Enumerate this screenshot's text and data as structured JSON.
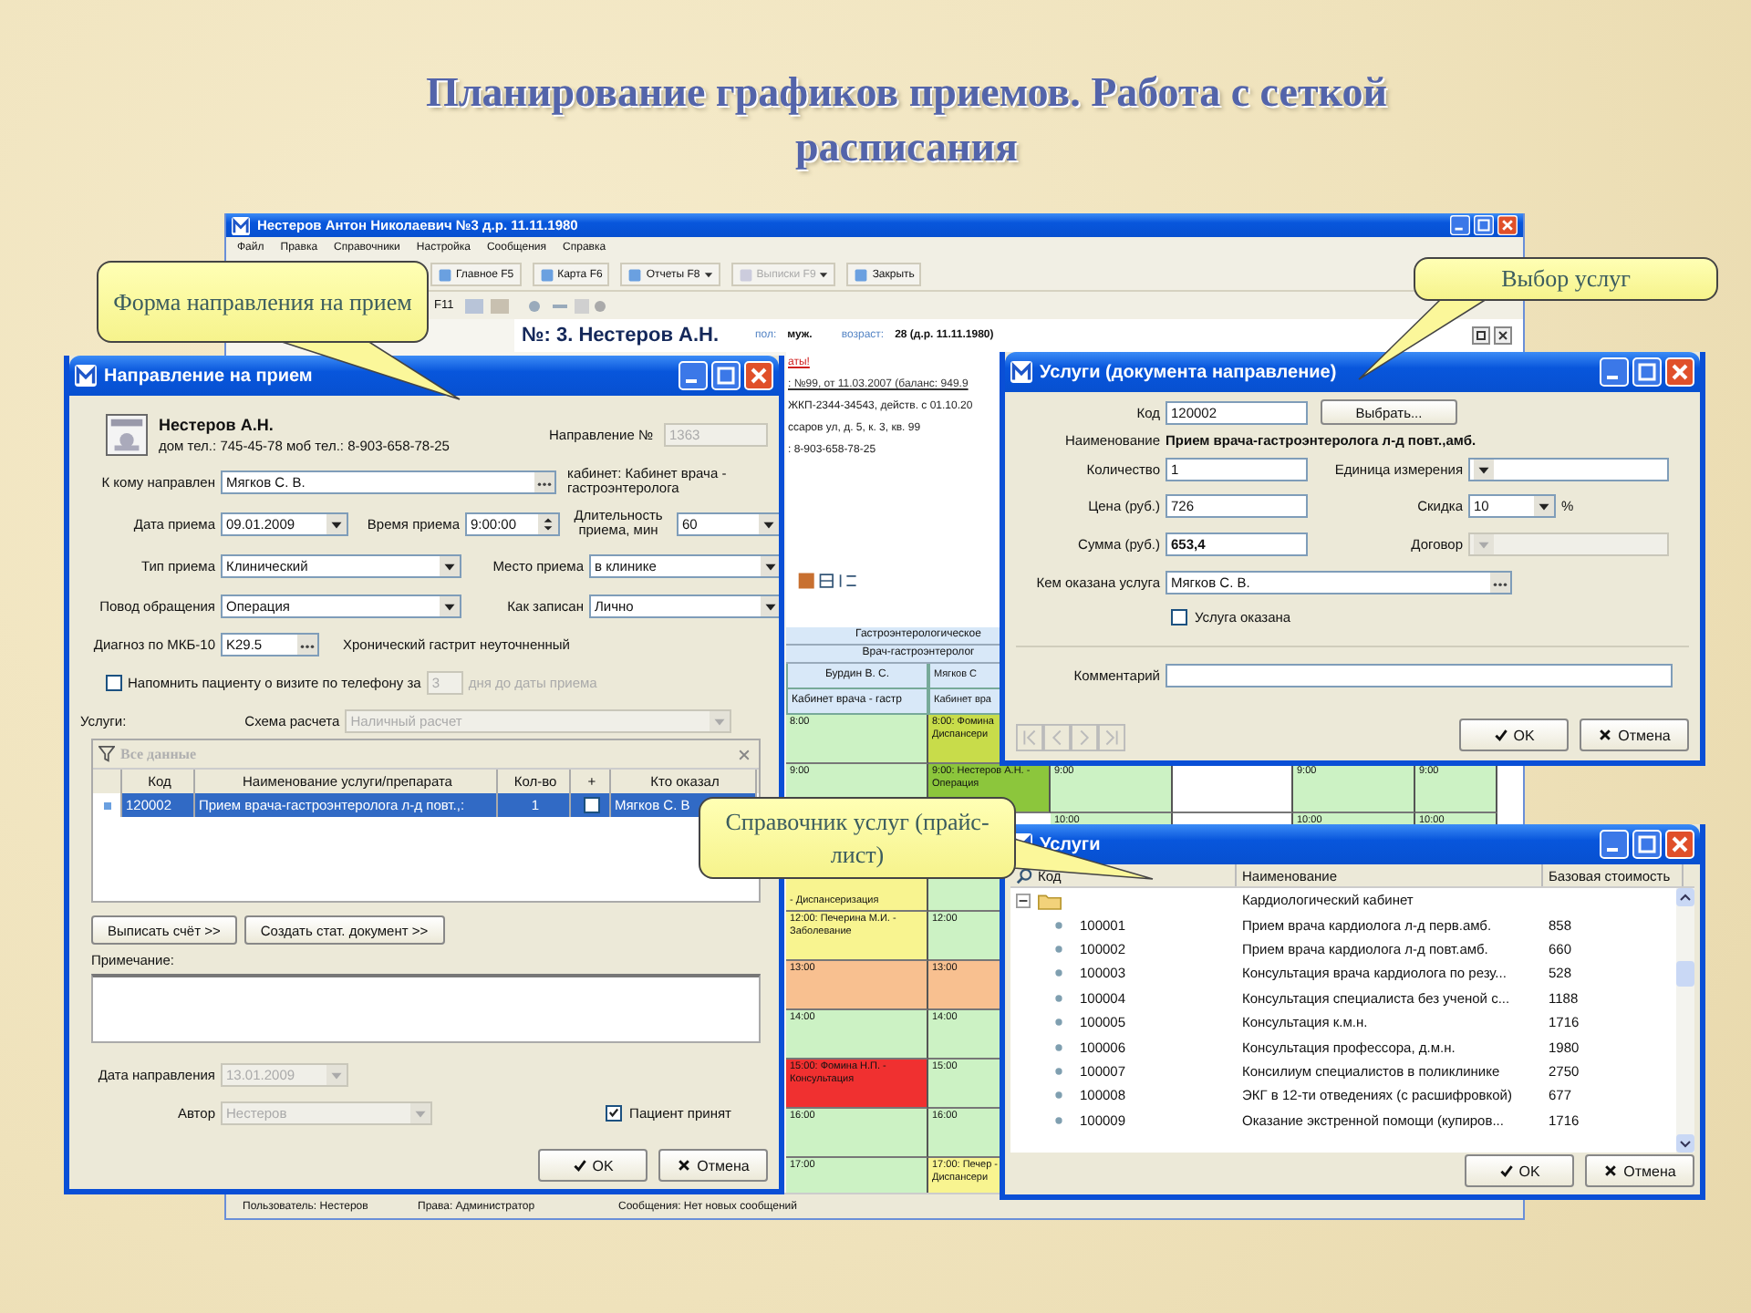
{
  "slide_title": "Планирование графиков приемов. Работа с сеткой расписания",
  "main_window": {
    "title": "Нестеров Антон Николаевич №3 д.р. 11.11.1980",
    "menu": [
      "Файл",
      "Правка",
      "Справочники",
      "Настройка",
      "Сообщения",
      "Справка"
    ],
    "toolbar": [
      {
        "label": "Главное F5",
        "disabled": false,
        "dropdown": false
      },
      {
        "label": "Карта F6",
        "disabled": false,
        "dropdown": false
      },
      {
        "label": "Отчеты F8",
        "disabled": false,
        "dropdown": true
      },
      {
        "label": "Выписки F9",
        "disabled": true,
        "dropdown": true
      },
      {
        "label": "Закрыть",
        "disabled": false,
        "dropdown": false
      }
    ],
    "toolbar2_label": "F11",
    "patient_header": {
      "number": "№: 3. Нестеров А.Н.",
      "sex_label": "пол:",
      "sex": "муж.",
      "age_label": "возраст:",
      "age": "28 (д.р. 11.11.1980)"
    },
    "info_lines": [
      {
        "text": "аты!",
        "kind": "warning"
      },
      {
        "text": ": №99, от 11.03.2007 (баланс: 949.9",
        "kind": "link"
      },
      {
        "text": "ЖКП-2344-34543, действ. с 01.10.20",
        "kind": "plain"
      },
      {
        "text": "ссаров ул, д. 5, к. 3, кв. 99",
        "kind": "plain"
      },
      {
        "text": ": 8-903-658-78-25",
        "kind": "plain"
      }
    ],
    "schedule": {
      "department": "Гастроэнтерологическое",
      "specialty": "Врач-гастроэнтеролог",
      "doctors": [
        "Бурдин В. С.",
        "Мягков С"
      ],
      "rooms": [
        "Кабинет врача - гастр",
        "Кабинет вра"
      ],
      "rows": [
        {
          "cells": [
            {
              "kind": "slot",
              "text": "8:00",
              "color": "#ccf2c4"
            },
            {
              "kind": "slot",
              "text": "8:00: Фомина Диспансери",
              "color": "#c8dc4a"
            }
          ]
        },
        {
          "cells": [
            {
              "kind": "slot",
              "text": "9:00",
              "color": "#ccf2c4"
            },
            {
              "kind": "slot",
              "text": "9:00: Нестеров А.Н. - Операция",
              "color": "#8cc63c"
            },
            {
              "kind": "slot",
              "text": "9:00",
              "color": "#ccf2c4"
            },
            {
              "kind": "slot",
              "color": "#ffffff"
            },
            {
              "kind": "slot",
              "text": "9:00",
              "color": "#ccf2c4"
            },
            {
              "kind": "slot",
              "text": "9:00",
              "color": "#ccf2c4"
            }
          ]
        },
        {
          "cells": [
            {},
            {},
            {
              "kind": "slot",
              "text": "10:00",
              "color": "#ccf2c4"
            },
            {
              "kind": "slot",
              "color": "#ffffff"
            },
            {
              "kind": "slot",
              "text": "10:00",
              "color": "#ccf2c4"
            },
            {
              "kind": "slot",
              "text": "10:00",
              "color": "#ccf2c4"
            }
          ]
        },
        {
          "cells": [
            {
              "kind": "continuation",
              "text": "- Диспансеризация",
              "color": "#f8f490"
            },
            {
              "kind": "slot",
              "color": "#ccf2c4"
            }
          ]
        },
        {
          "cells": [
            {
              "kind": "slot",
              "text": "12:00: Печерина М.И. - Заболевание",
              "color": "#f8f490"
            },
            {
              "kind": "slot",
              "text": "12:00",
              "color": "#ccf2c4"
            }
          ]
        },
        {
          "cells": [
            {
              "kind": "slot",
              "text": "13:00",
              "color": "#f8c090"
            },
            {
              "kind": "slot",
              "text": "13:00",
              "color": "#f8c090"
            }
          ]
        },
        {
          "cells": [
            {
              "kind": "slot",
              "text": "14:00",
              "color": "#ccf2c4"
            },
            {
              "kind": "slot",
              "text": "14:00",
              "color": "#ccf2c4"
            }
          ]
        },
        {
          "cells": [
            {
              "kind": "slot",
              "text": "15:00: Фомина Н.П. - Консультация",
              "color": "#f03030"
            },
            {
              "kind": "slot",
              "text": "15:00",
              "color": "#ccf2c4"
            }
          ]
        },
        {
          "cells": [
            {
              "kind": "slot",
              "text": "16:00",
              "color": "#ccf2c4"
            },
            {
              "kind": "slot",
              "text": "16:00",
              "color": "#ccf2c4"
            }
          ]
        },
        {
          "cells": [
            {
              "kind": "slot",
              "text": "17:00",
              "color": "#ccf2c4"
            },
            {
              "kind": "slot",
              "text": "17:00: Печер - Диспансери",
              "color": "#f8f490"
            }
          ]
        }
      ]
    },
    "status_bar": [
      "Пользователь:  Нестеров",
      "Права:  Администратор",
      "Сообщения:  Нет новых сообщений"
    ]
  },
  "referral_dialog": {
    "title": "Направление на прием",
    "patient_name": "Нестеров А.Н.",
    "patient_phones": "дом тел.: 745-45-78 моб тел.: 8-903-658-78-25",
    "number": {
      "label": "Направление №",
      "value": "1363",
      "kind": "text",
      "disabled": true
    },
    "to_whom": {
      "label": "К кому направлен",
      "value": "Мягков С. В.",
      "kind": "lookup",
      "disabled": false
    },
    "room_note": "кабинет: Кабинет врача - гастроэнтеролога",
    "date": {
      "label": "Дата приема",
      "value": "09.01.2009",
      "kind": "combo",
      "disabled": false
    },
    "time": {
      "label": "Время приема",
      "value": "9:00:00",
      "kind": "spin",
      "disabled": false
    },
    "duration": {
      "label": "Длительность приема, мин",
      "value": "60",
      "kind": "combo",
      "disabled": false
    },
    "type": {
      "label": "Тип приема",
      "value": "Клинический",
      "kind": "combo",
      "disabled": false
    },
    "place": {
      "label": "Место приема",
      "value": "в клинике",
      "kind": "combo",
      "disabled": false
    },
    "reason": {
      "label": "Повод обращения",
      "value": "Операция",
      "kind": "combo",
      "disabled": false
    },
    "recorded": {
      "label": "Как записан",
      "value": "Лично",
      "kind": "combo",
      "disabled": false
    },
    "diagnosis": {
      "label": "Диагноз по МКБ-10",
      "value": "K29.5",
      "kind": "lookup",
      "disabled": false
    },
    "diagnosis_text": "Хронический гастрит неуточненный",
    "reminder": {
      "label": "Напомнить пациенту о визите по телефону за",
      "checked": false,
      "days": "3",
      "suffix": "дня до даты приема",
      "disabled": true
    },
    "services_label": "Услуги:",
    "payment": {
      "label": "Схема расчета",
      "value": "Наличный расчет",
      "kind": "combo",
      "disabled": true
    },
    "filter": "Все данные",
    "columns": [
      "Код",
      "Наименование услуги/препарата",
      "Кол-во",
      "+",
      "Кто оказал"
    ],
    "rows": [
      {
        "code": "120002",
        "name": "Прием врача-гастроэнтеролога л-д повт.,:",
        "qty": "1",
        "extra": false,
        "by": "Мягков С. В",
        "selected": true
      }
    ],
    "actions": [
      "Выписать счёт >>",
      "Создать стат. документ >>"
    ],
    "note_label": "Примечание:",
    "referral_date": {
      "label": "Дата направления",
      "value": "13.01.2009",
      "kind": "combo",
      "disabled": true
    },
    "author": {
      "label": "Автор",
      "value": "Нестеров",
      "kind": "combo",
      "disabled": true
    },
    "accepted": {
      "label": "Пациент принят",
      "checked": true
    },
    "ok": "OK",
    "cancel": "Отмена"
  },
  "service_dialog": {
    "title": "Услуги (документа направление)",
    "code": {
      "label": "Код",
      "value": "120002",
      "kind": "text",
      "disabled": false
    },
    "choose_button": "Выбрать...",
    "name_label": "Наименование",
    "name_value": "Прием врача-гастроэнтеролога л-д повт.,амб.",
    "quantity": {
      "label": "Количество",
      "value": "1",
      "kind": "text",
      "disabled": false
    },
    "unit": {
      "label": "Единица измерения",
      "kind": "combo",
      "disabled": false
    },
    "price": {
      "label": "Цена (руб.)",
      "value": "726",
      "kind": "text",
      "disabled": false
    },
    "discount": {
      "label": "Скидка",
      "value": "10",
      "kind": "combo",
      "disabled": false
    },
    "percent": "%",
    "sum": {
      "label": "Сумма (руб.)",
      "value": "653,4",
      "kind": "text",
      "disabled": false
    },
    "contract": {
      "label": "Договор",
      "kind": "combo",
      "disabled": true
    },
    "performer": {
      "label": "Кем оказана услуга",
      "value": "Мягков С. В.",
      "kind": "lookup",
      "disabled": false
    },
    "done": {
      "label": "Услуга оказана",
      "checked": false
    },
    "comment_label": "Комментарий",
    "nav_disabled": true,
    "ok": "OK",
    "cancel": "Отмена"
  },
  "price_list": {
    "title": "Услуги",
    "columns": [
      "Код",
      "Наименование",
      "Базовая стоимость"
    ],
    "group": {
      "name": "Кардиологический кабинет",
      "expanded": true,
      "children": [
        {
          "code": "100001",
          "name": "Прием врача кардиолога л-д перв.амб.",
          "price": "858"
        },
        {
          "code": "100002",
          "name": "Прием врача кардиолога л-д повт.амб.",
          "price": "660"
        },
        {
          "code": "100003",
          "name": "Консультация врача кардиолога по резу...",
          "price": "528"
        },
        {
          "code": "100004",
          "name": "Консультация специалиста без ученой с...",
          "price": "1188"
        },
        {
          "code": "100005",
          "name": "Консультация к.м.н.",
          "price": "1716"
        },
        {
          "code": "100006",
          "name": "Консультация профессора, д.м.н.",
          "price": "1980"
        },
        {
          "code": "100007",
          "name": "Консилиум специалистов в поликлинике",
          "price": "2750"
        },
        {
          "code": "100008",
          "name": "ЭКГ в 12-ти отведениях (с расшифровкой)",
          "price": "677"
        },
        {
          "code": "100009",
          "name": "Оказание экстренной помощи (купиров...",
          "price": "1716"
        }
      ]
    },
    "ok": "OK",
    "cancel": "Отмена"
  },
  "callouts": [
    {
      "text": "Форма направления на прием"
    },
    {
      "text": "Выбор услуг"
    },
    {
      "text": "Справочник услуг (прайс-лист)"
    }
  ]
}
